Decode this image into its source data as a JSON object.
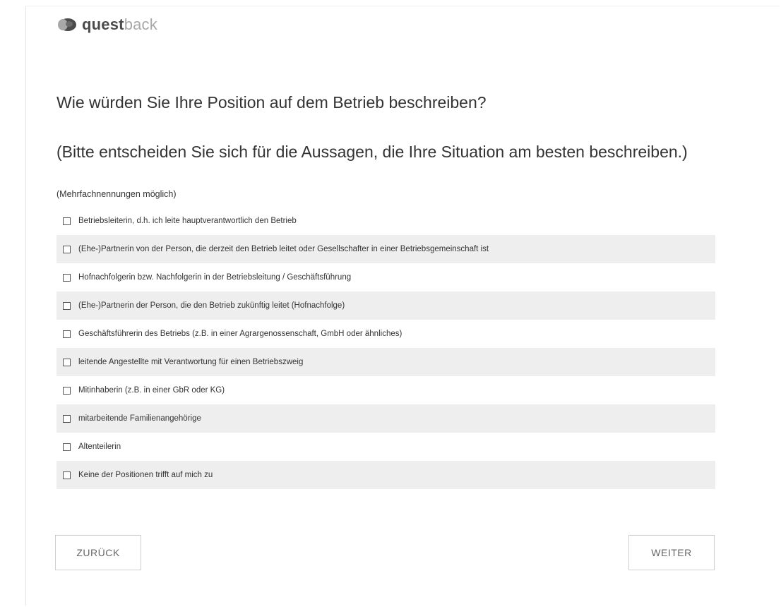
{
  "brand": {
    "name_strong": "quest",
    "name_light": "back",
    "logo_icon": "questback-logo-icon",
    "color_dark": "#4b4b4b",
    "color_light": "#a8a8a8"
  },
  "question": {
    "title": "Wie würden Sie Ihre Position auf dem Betrieb beschreiben?",
    "instruction": "(Bitte entscheiden Sie sich für die Aussagen, die Ihre Situation am besten beschreiben.)",
    "hint": "(Mehrfachnennungen möglich)"
  },
  "options": [
    {
      "label": "Betriebsleiterin, d.h. ich leite hauptverantwortlich den Betrieb",
      "checked": false
    },
    {
      "label": "(Ehe-)Partnerin von der Person, die derzeit den Betrieb leitet oder Gesellschafter in einer Betriebsgemeinschaft ist",
      "checked": false
    },
    {
      "label": "Hofnachfolgerin bzw. Nachfolgerin in der Betriebsleitung / Geschäftsführung",
      "checked": false
    },
    {
      "label": "(Ehe-)Partnerin der Person, die den Betrieb zukünftig leitet (Hofnachfolge)",
      "checked": false
    },
    {
      "label": "Geschäftsführerin des Betriebs (z.B. in einer Agrargenossenschaft, GmbH oder ähnliches)",
      "checked": false
    },
    {
      "label": "leitende Angestellte mit Verantwortung für einen Betriebszweig",
      "checked": false
    },
    {
      "label": "Mitinhaberin (z.B. in einer GbR oder KG)",
      "checked": false
    },
    {
      "label": "mitarbeitende Familienangehörige",
      "checked": false
    },
    {
      "label": "Altenteilerin",
      "checked": false
    },
    {
      "label": "Keine der Positionen trifft auf mich zu",
      "checked": false
    }
  ],
  "navigation": {
    "back_label": "ZURÜCK",
    "next_label": "WEITER"
  },
  "colors": {
    "row_alt_background": "#eeeeee",
    "text": "#333333",
    "button_border": "#cfcfcf"
  }
}
